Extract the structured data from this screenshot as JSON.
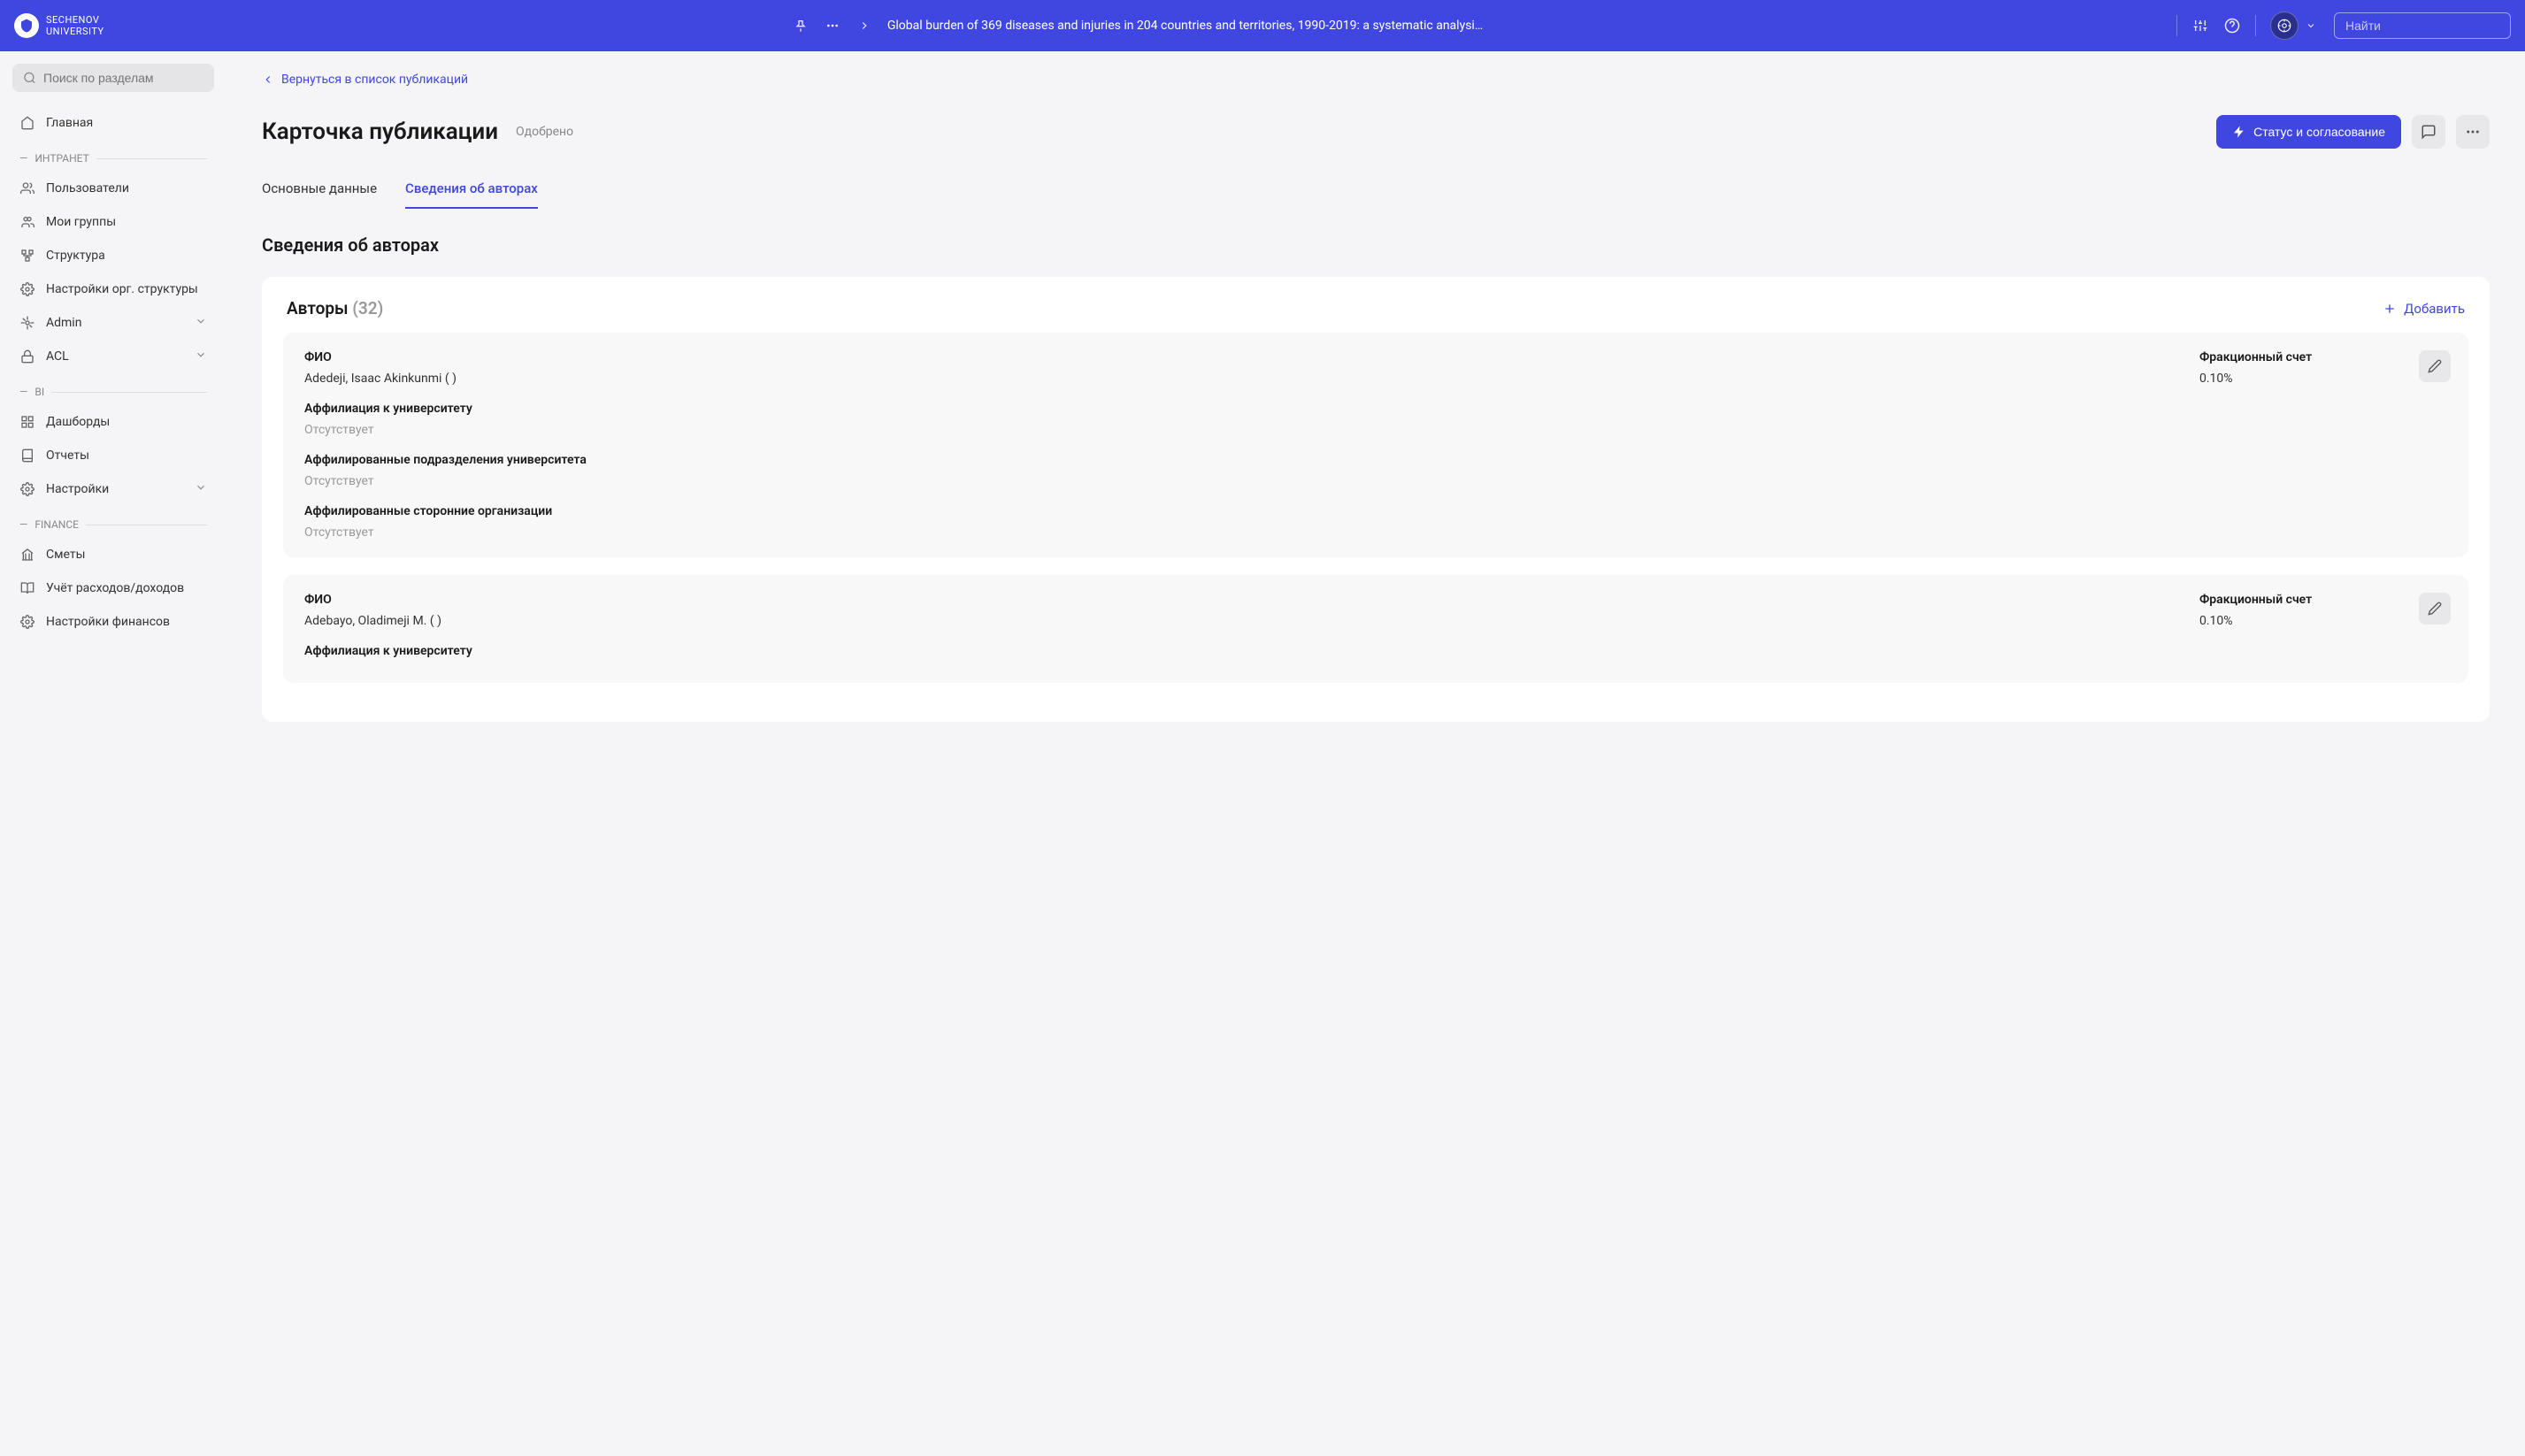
{
  "header": {
    "logo_line1": "SECHENOV",
    "logo_line2": "UNIVERSITY",
    "breadcrumb": "Global burden of 369 diseases and injuries in 204 countries and territories, 1990-2019: a systematic analysis for th...",
    "search_placeholder": "Найти"
  },
  "sidebar": {
    "search_placeholder": "Поиск по разделам",
    "home": "Главная",
    "sections": {
      "intranet": {
        "label": "ИНТРАНЕТ",
        "items": [
          "Пользователи",
          "Мои группы",
          "Структура",
          "Настройки орг. структуры",
          "Admin",
          "ACL"
        ]
      },
      "bi": {
        "label": "BI",
        "items": [
          "Дашборды",
          "Отчеты",
          "Настройки"
        ]
      },
      "finance": {
        "label": "FINANCE",
        "items": [
          "Сметы",
          "Учёт расходов/доходов",
          "Настройки финансов"
        ]
      }
    }
  },
  "main": {
    "back_link": "Вернуться в список публикаций",
    "title": "Карточка публикации",
    "status": "Одобрено",
    "status_btn": "Статус и согласование",
    "tabs": [
      "Основные данные",
      "Сведения об авторах"
    ],
    "section_title": "Сведения об авторах",
    "authors_label": "Авторы",
    "authors_count": "(32)",
    "add_btn": "Добавить",
    "labels": {
      "fio": "ФИО",
      "frac": "Фракционный счет",
      "affil_uni": "Аффилиация к университету",
      "affil_dept": "Аффилированные подразделения университета",
      "affil_ext": "Аффилированные сторонние организации",
      "absent": "Отсутствует"
    },
    "authors": [
      {
        "name": "Adedeji, Isaac Akinkunmi (  )",
        "frac": "0.10%"
      },
      {
        "name": "Adebayo, Oladimeji M. (  )",
        "frac": "0.10%"
      }
    ]
  }
}
